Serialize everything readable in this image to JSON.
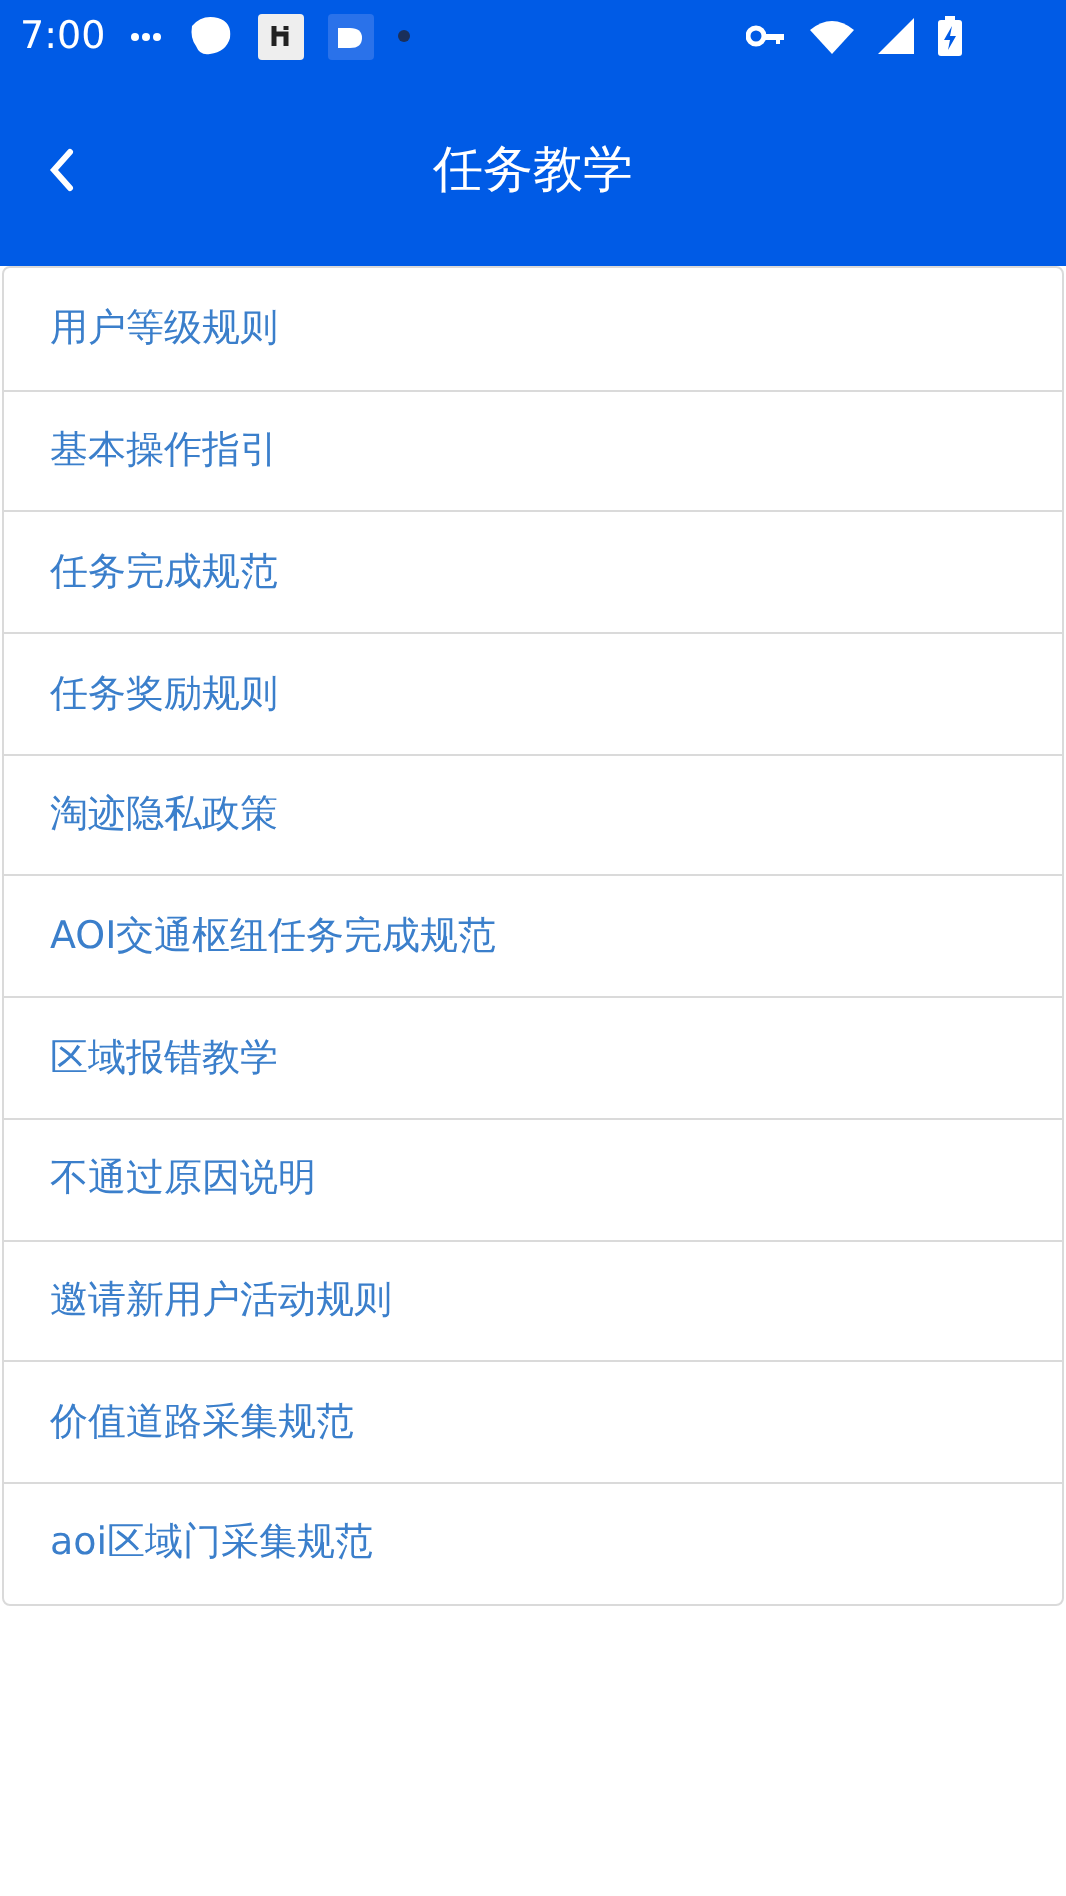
{
  "status_bar": {
    "time": "7:00"
  },
  "header": {
    "title": "任务教学"
  },
  "items": [
    {
      "label": "用户等级规则"
    },
    {
      "label": "基本操作指引"
    },
    {
      "label": "任务完成规范"
    },
    {
      "label": "任务奖励规则"
    },
    {
      "label": "淘迹隐私政策"
    },
    {
      "label": "AOI交通枢纽任务完成规范"
    },
    {
      "label": "区域报错教学"
    },
    {
      "label": "不通过原因说明"
    },
    {
      "label": "邀请新用户活动规则"
    },
    {
      "label": "价值道路采集规范"
    },
    {
      "label": "aoi区域门采集规范"
    }
  ]
}
